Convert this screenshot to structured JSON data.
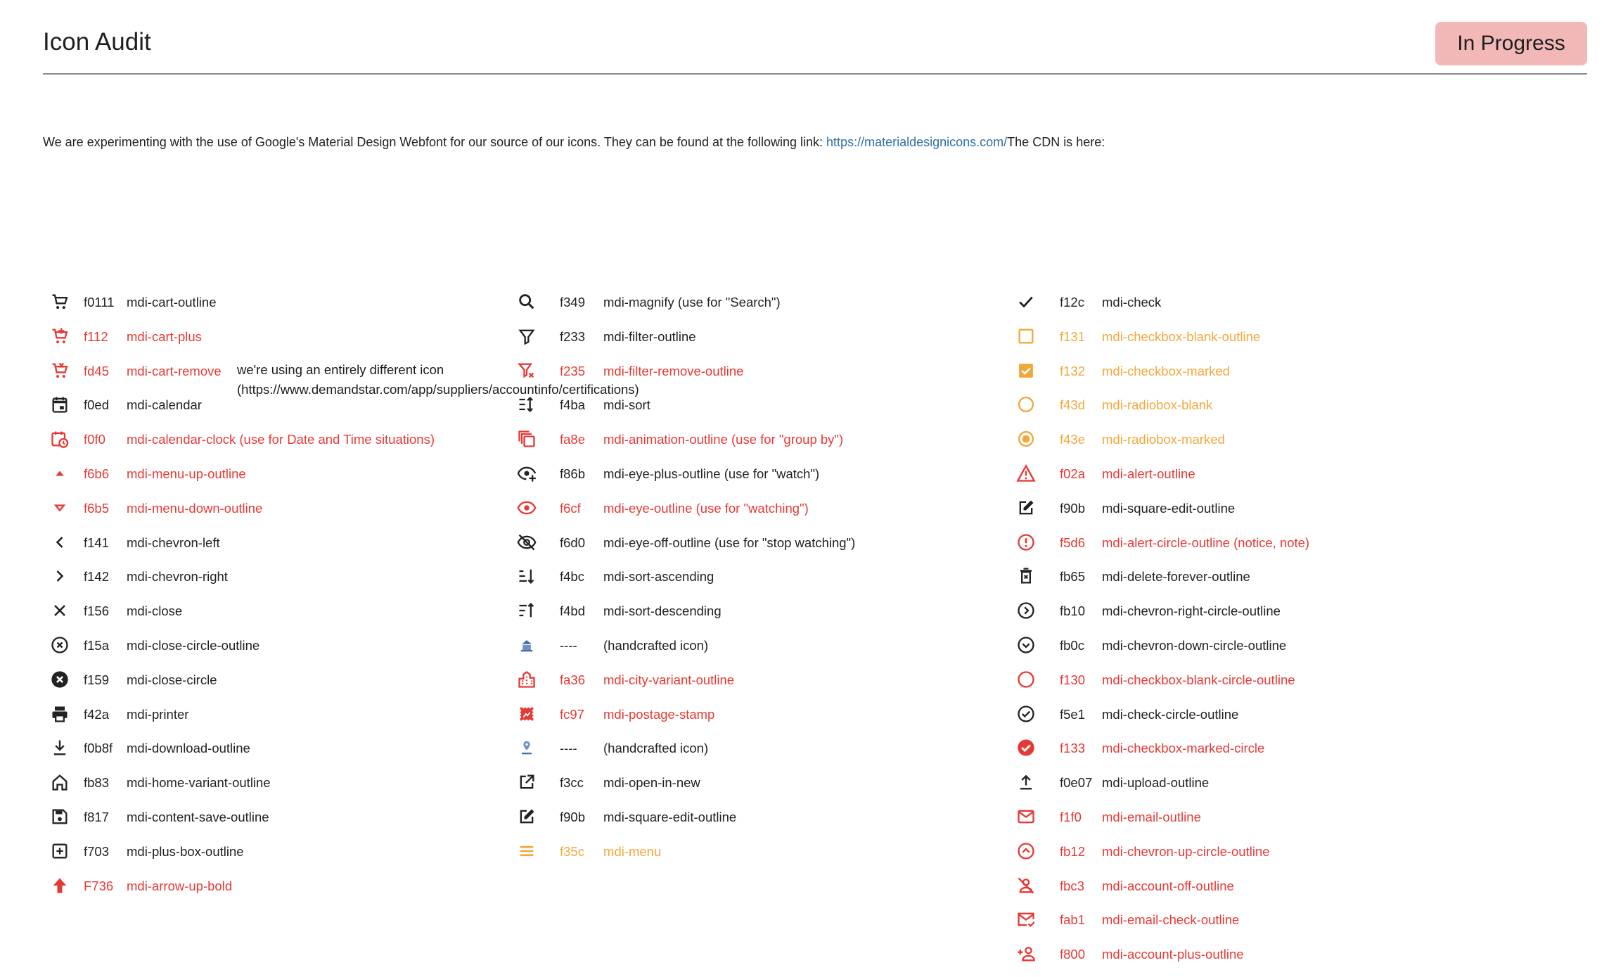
{
  "header": {
    "title": "Icon Audit",
    "status": "In Progress",
    "status_color": "#f2b8b8"
  },
  "intro": {
    "text": "We are experimenting with the use of Google's Material Design Webfont for our source of our icons. They can be found at the following link: ",
    "link": "https://materialdesignicons.com/",
    "suffix": "The CDN is here:"
  },
  "note": "we're using an entirely different icon (https://www.demandstar.com/app/suppliers/accountinfo/certifications)",
  "colors": {
    "default": "#222222",
    "red": "#e53935",
    "orange": "#f3a73b"
  },
  "columns": [
    [
      {
        "icon": "cart-outline-icon",
        "code": "f0111",
        "name": "mdi-cart-outline",
        "status": "default"
      },
      {
        "icon": "cart-plus-icon",
        "code": "f112",
        "name": "mdi-cart-plus",
        "status": "red"
      },
      {
        "icon": "cart-remove-icon",
        "code": "fd45",
        "name": "mdi-cart-remove",
        "status": "red"
      },
      {
        "icon": "calendar-icon",
        "code": "f0ed",
        "name": "mdi-calendar",
        "status": "default"
      },
      {
        "icon": "calendar-clock-icon",
        "code": "f0f0",
        "name": "mdi-calendar-clock (use for Date and Time situations)",
        "status": "red"
      },
      {
        "icon": "menu-up-outline-icon",
        "code": "f6b6",
        "name": "mdi-menu-up-outline",
        "status": "red"
      },
      {
        "icon": "menu-down-outline-icon",
        "code": "f6b5",
        "name": "mdi-menu-down-outline",
        "status": "red"
      },
      {
        "icon": "chevron-left-icon",
        "code": "f141",
        "name": "mdi-chevron-left",
        "status": "default"
      },
      {
        "icon": "chevron-right-icon",
        "code": "f142",
        "name": "mdi-chevron-right",
        "status": "default"
      },
      {
        "icon": "close-icon",
        "code": "f156",
        "name": "mdi-close",
        "status": "default"
      },
      {
        "icon": "close-circle-outline-icon",
        "code": "f15a",
        "name": "mdi-close-circle-outline",
        "status": "default"
      },
      {
        "icon": "close-circle-icon",
        "code": "f159",
        "name": "mdi-close-circle",
        "status": "default"
      },
      {
        "icon": "printer-icon",
        "code": "f42a",
        "name": "mdi-printer",
        "status": "default"
      },
      {
        "icon": "download-outline-icon",
        "code": "f0b8f",
        "name": "mdi-download-outline",
        "status": "default"
      },
      {
        "icon": "home-variant-outline-icon",
        "code": "fb83",
        "name": "mdi-home-variant-outline",
        "status": "default"
      },
      {
        "icon": "content-save-outline-icon",
        "code": "f817",
        "name": "mdi-content-save-outline",
        "status": "default"
      },
      {
        "icon": "plus-box-outline-icon",
        "code": "f703",
        "name": "mdi-plus-box-outline",
        "status": "default"
      },
      {
        "icon": "arrow-up-bold-icon",
        "code": "F736",
        "name": "mdi-arrow-up-bold",
        "status": "red"
      }
    ],
    [
      {
        "icon": "magnify-icon",
        "code": "f349",
        "name": "mdi-magnify (use for \"Search\")",
        "status": "default"
      },
      {
        "icon": "filter-outline-icon",
        "code": "f233",
        "name": "mdi-filter-outline",
        "status": "default"
      },
      {
        "icon": "filter-remove-outline-icon",
        "code": "f235",
        "name": "mdi-filter-remove-outline",
        "status": "red"
      },
      {
        "icon": "sort-icon",
        "code": "f4ba",
        "name": "mdi-sort",
        "status": "default"
      },
      {
        "icon": "animation-outline-icon",
        "code": "fa8e",
        "name": "mdi-animation-outline (use for \"group by\")",
        "status": "red"
      },
      {
        "icon": "eye-plus-outline-icon",
        "code": "f86b",
        "name": "mdi-eye-plus-outline (use for \"watch\")",
        "status": "default"
      },
      {
        "icon": "eye-outline-icon",
        "code": "f6cf",
        "name": "mdi-eye-outline (use for \"watching\")",
        "status": "red"
      },
      {
        "icon": "eye-off-outline-icon",
        "code": "f6d0",
        "name": "mdi-eye-off-outline (use for \"stop watching\")",
        "status": "default"
      },
      {
        "icon": "sort-ascending-icon",
        "code": "f4bc",
        "name": "mdi-sort-ascending",
        "status": "default"
      },
      {
        "icon": "sort-descending-icon",
        "code": "f4bd",
        "name": "mdi-sort-descending",
        "status": "default"
      },
      {
        "icon": "handcrafted-building-icon",
        "code": "----",
        "name": "(handcrafted icon)",
        "status": "default"
      },
      {
        "icon": "city-variant-outline-icon",
        "code": "fa36",
        "name": "mdi-city-variant-outline",
        "status": "red"
      },
      {
        "icon": "postage-stamp-icon",
        "code": "fc97",
        "name": "mdi-postage-stamp",
        "status": "red"
      },
      {
        "icon": "handcrafted-location-icon",
        "code": "----",
        "name": "(handcrafted icon)",
        "status": "default"
      },
      {
        "icon": "open-in-new-icon",
        "code": "f3cc",
        "name": "mdi-open-in-new",
        "status": "default"
      },
      {
        "icon": "square-edit-outline-icon",
        "code": "f90b",
        "name": "mdi-square-edit-outline",
        "status": "default"
      },
      {
        "icon": "menu-icon",
        "code": "f35c",
        "name": "mdi-menu",
        "status": "orange"
      }
    ],
    [
      {
        "icon": "check-icon",
        "code": "f12c",
        "name": "mdi-check",
        "status": "default"
      },
      {
        "icon": "checkbox-blank-outline-icon",
        "code": "f131",
        "name": "mdi-checkbox-blank-outline",
        "status": "orange"
      },
      {
        "icon": "checkbox-marked-icon",
        "code": "f132",
        "name": "mdi-checkbox-marked",
        "status": "orange"
      },
      {
        "icon": "radiobox-blank-icon",
        "code": "f43d",
        "name": "mdi-radiobox-blank",
        "status": "orange"
      },
      {
        "icon": "radiobox-marked-icon",
        "code": "f43e",
        "name": "mdi-radiobox-marked",
        "status": "orange"
      },
      {
        "icon": "alert-outline-icon",
        "code": "f02a",
        "name": "mdi-alert-outline",
        "status": "red"
      },
      {
        "icon": "square-edit-outline-icon",
        "code": "f90b",
        "name": "mdi-square-edit-outline",
        "status": "default"
      },
      {
        "icon": "alert-circle-outline-icon",
        "code": "f5d6",
        "name": "mdi-alert-circle-outline (notice, note)",
        "status": "red"
      },
      {
        "icon": "delete-forever-outline-icon",
        "code": "fb65",
        "name": "mdi-delete-forever-outline",
        "status": "default"
      },
      {
        "icon": "chevron-right-circle-outline-icon",
        "code": "fb10",
        "name": "mdi-chevron-right-circle-outline",
        "status": "default"
      },
      {
        "icon": "chevron-down-circle-outline-icon",
        "code": "fb0c",
        "name": "mdi-chevron-down-circle-outline",
        "status": "default"
      },
      {
        "icon": "checkbox-blank-circle-outline-icon",
        "code": "f130",
        "name": "mdi-checkbox-blank-circle-outline",
        "status": "red"
      },
      {
        "icon": "check-circle-outline-icon",
        "code": "f5e1",
        "name": "mdi-check-circle-outline",
        "status": "default"
      },
      {
        "icon": "checkbox-marked-circle-icon",
        "code": "f133",
        "name": "mdi-checkbox-marked-circle",
        "status": "red"
      },
      {
        "icon": "upload-outline-icon",
        "code": "f0e07",
        "name": "mdi-upload-outline",
        "status": "default"
      },
      {
        "icon": "email-outline-icon",
        "code": "f1f0",
        "name": "mdi-email-outline",
        "status": "red"
      },
      {
        "icon": "chevron-up-circle-outline-icon",
        "code": "fb12",
        "name": "mdi-chevron-up-circle-outline",
        "status": "red"
      },
      {
        "icon": "account-off-outline-icon",
        "code": "fbc3",
        "name": "mdi-account-off-outline",
        "status": "red"
      },
      {
        "icon": "email-check-outline-icon",
        "code": "fab1",
        "name": "mdi-email-check-outline",
        "status": "red"
      },
      {
        "icon": "account-plus-outline-icon",
        "code": "f800",
        "name": "mdi-account-plus-outline",
        "status": "red"
      }
    ]
  ]
}
